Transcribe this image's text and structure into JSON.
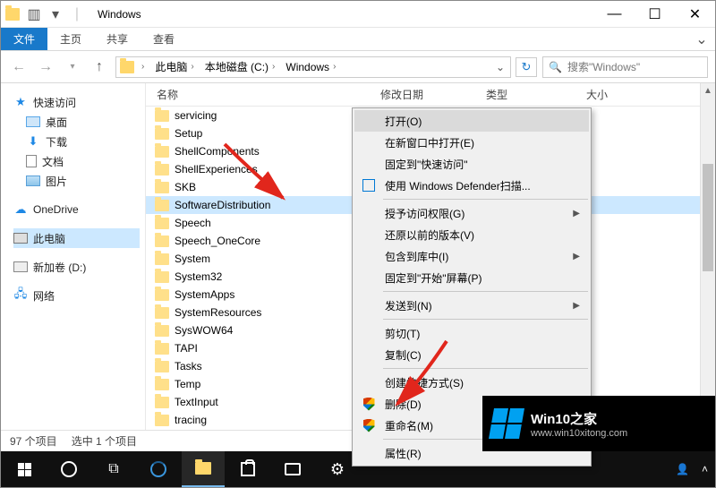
{
  "window": {
    "title": "Windows"
  },
  "ribbon": {
    "file": "文件",
    "tabs": [
      "主页",
      "共享",
      "查看"
    ]
  },
  "breadcrumb": {
    "segs": [
      "此电脑",
      "本地磁盘 (C:)",
      "Windows"
    ]
  },
  "search": {
    "placeholder": "搜索\"Windows\""
  },
  "tree": {
    "quick": {
      "label": "快速访问",
      "items": [
        "桌面",
        "下载",
        "文档",
        "图片"
      ]
    },
    "onedrive": "OneDrive",
    "thispc": "此电脑",
    "drive": "新加卷 (D:)",
    "network": "网络"
  },
  "columns": {
    "name": "名称",
    "date": "修改日期",
    "type": "类型",
    "size": "大小"
  },
  "rows": [
    "servicing",
    "Setup",
    "ShellComponents",
    "ShellExperiences",
    "SKB",
    "SoftwareDistribution",
    "Speech",
    "Speech_OneCore",
    "System",
    "System32",
    "SystemApps",
    "SystemResources",
    "SysWOW64",
    "TAPI",
    "Tasks",
    "Temp",
    "TextInput",
    "tracing"
  ],
  "selected_row": "SoftwareDistribution",
  "status": {
    "count": "97 个项目",
    "sel": "选中 1 个项目"
  },
  "ctx": {
    "open": "打开(O)",
    "newwin": "在新窗口中打开(E)",
    "pinquick": "固定到\"快速访问\"",
    "defender": "使用 Windows Defender扫描...",
    "grant": "授予访问权限(G)",
    "restore": "还原以前的版本(V)",
    "include": "包含到库中(I)",
    "pinstart": "固定到\"开始\"屏幕(P)",
    "sendto": "发送到(N)",
    "cut": "剪切(T)",
    "copy": "复制(C)",
    "shortcut": "创建快捷方式(S)",
    "delete": "删除(D)",
    "rename": "重命名(M)",
    "props": "属性(R)"
  },
  "watermark": {
    "brand": "Win10之家",
    "url": "www.win10xitong.com"
  }
}
